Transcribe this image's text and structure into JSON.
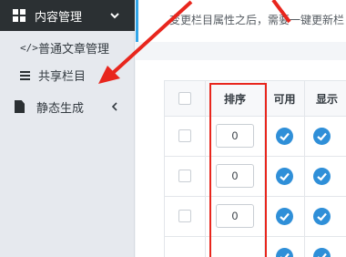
{
  "sidebar": {
    "header": {
      "label": "内容管理",
      "icon": "grid-icon",
      "chevron": "chevron-down-icon"
    },
    "items": [
      {
        "label": "普通文章管理",
        "icon": "code-icon",
        "icon_glyph": "</>"
      },
      {
        "label": "共享栏目",
        "icon": "list-icon"
      }
    ],
    "static": {
      "label": "静态生成",
      "icon": "document-icon",
      "chevron": "chevron-left-icon"
    }
  },
  "notice": {
    "text": "变更栏目属性之后，需要一键更新栏"
  },
  "table": {
    "headers": [
      "排序",
      "可用",
      "显示"
    ],
    "rows": [
      {
        "sort": "0",
        "enabled": true,
        "visible": true
      },
      {
        "sort": "0",
        "enabled": true,
        "visible": true
      },
      {
        "sort": "0",
        "enabled": true,
        "visible": true
      },
      {
        "sort": "0",
        "enabled": true,
        "visible": true
      }
    ]
  },
  "colors": {
    "accent": "#32a5e8",
    "check_blue": "#2f8fd8",
    "highlight_red": "#e8261d",
    "header_dark": "#2b3033"
  }
}
